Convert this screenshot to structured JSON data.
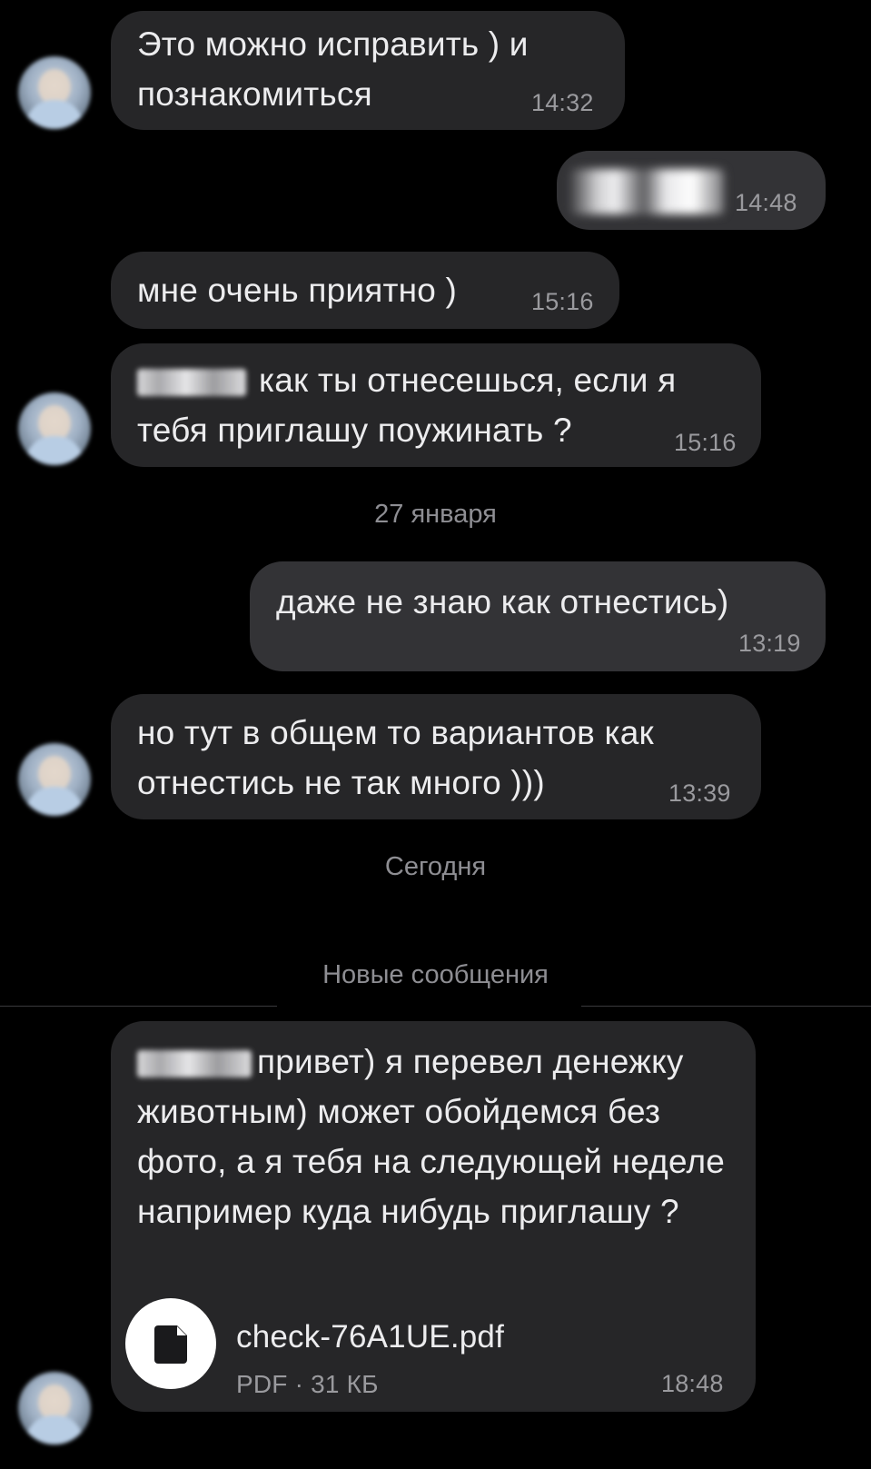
{
  "messages": [
    {
      "id": "m1",
      "text": "Это можно исправить ) и познакомиться",
      "time": "14:32"
    },
    {
      "id": "m2",
      "text": "",
      "time": "14:48"
    },
    {
      "id": "m3",
      "text": "мне очень приятно )",
      "time": "15:16"
    },
    {
      "id": "m4",
      "text": "как ты отнесешься, если я тебя приглашу поужинать ?",
      "time": "15:16"
    },
    {
      "id": "m5",
      "text": "даже не знаю как отнестись)",
      "time": "13:19"
    },
    {
      "id": "m6",
      "text": "но тут в общем то вариантов как отнестись не так много )))",
      "time": "13:39"
    },
    {
      "id": "m7",
      "text": "привет) я перевел денежку животным) может обойдемся без фото, а я тебя на следующей неделе например куда нибудь приглашу ?",
      "time": "18:48"
    }
  ],
  "separators": {
    "date1": "27 января",
    "date2": "Сегодня",
    "new_messages": "Новые сообщения"
  },
  "attachment": {
    "name": "check-76A1UE.pdf",
    "meta": "PDF · 31 КБ",
    "icon": "file-icon"
  },
  "colors": {
    "background": "#000000",
    "incoming_bubble": "#262628",
    "outgoing_bubble": "#333336",
    "secondary_text": "#9a9a9e"
  }
}
